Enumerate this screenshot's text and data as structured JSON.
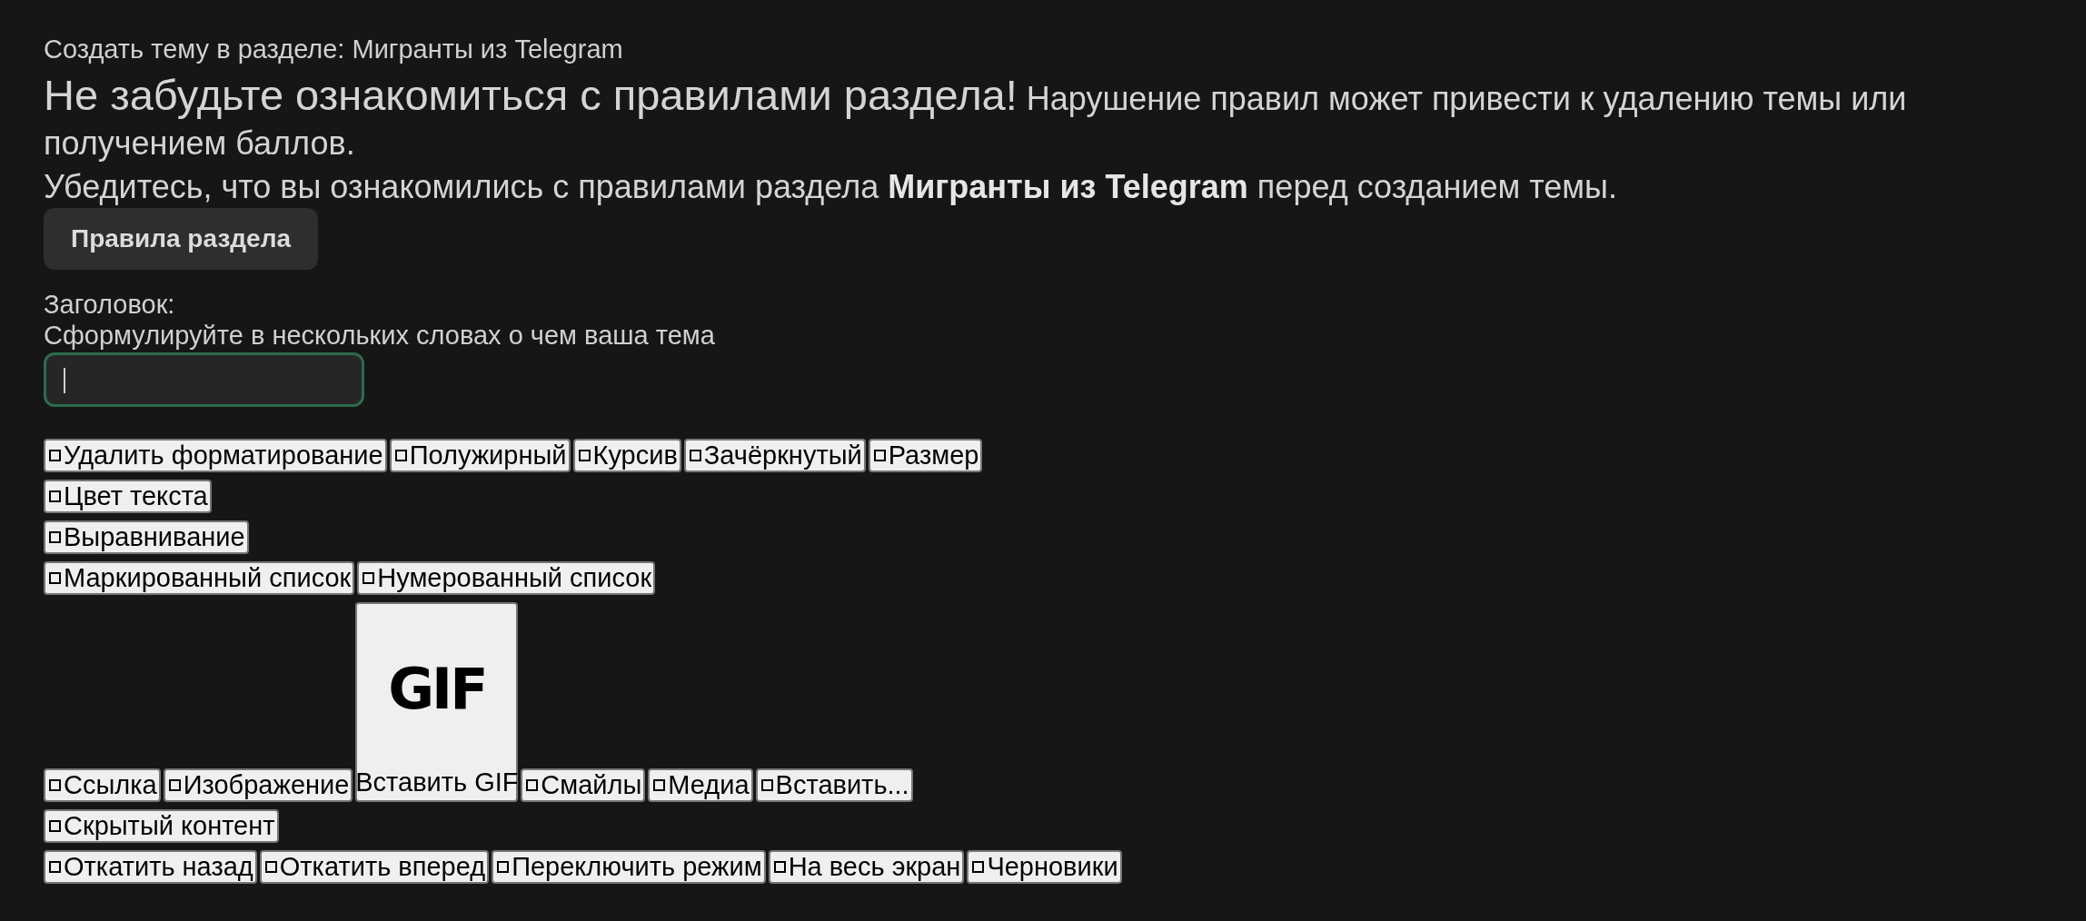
{
  "breadcrumb": "Создать тему в разделе: Мигранты из Telegram",
  "notice": {
    "headline": "Не забудьте ознакомиться с правилами раздела!",
    "text": "Нарушение правил может привести к удалению темы или получением баллов."
  },
  "reminder": "Убедитесь, что вы ознакомились с правилами раздела **Мигранты из Telegram** перед созданием темы.",
  "rules_button": {
    "label": "Правила раздела"
  },
  "title_field": {
    "label": "Заголовок:",
    "hint": "Сформулируйте в нескольких словах о чем ваша тема",
    "focused": true
  },
  "toolbar": {
    "lines": [
      {
        "buttons": [
          {
            "kind": "icon",
            "label": "Удалить форматирование"
          },
          {
            "kind": "icon",
            "label": "Полужирный"
          },
          {
            "kind": "icon",
            "label": "Курсив"
          },
          {
            "kind": "icon",
            "label": "Зачёркнутый"
          },
          {
            "kind": "icon",
            "label": "Размер"
          }
        ]
      },
      {
        "buttons": [
          {
            "kind": "icon",
            "label": "Цвет текста"
          }
        ]
      },
      {
        "buttons": [
          {
            "kind": "icon",
            "label": "Выравнивание"
          }
        ]
      },
      {
        "buttons": [
          {
            "kind": "icon",
            "label": "Маркированный список"
          },
          {
            "kind": "icon",
            "label": "Нумерованный список"
          }
        ]
      },
      {
        "buttons": [
          {
            "kind": "icon",
            "label": "Ссылка"
          },
          {
            "kind": "icon",
            "label": "Изображение"
          },
          {
            "kind": "gif",
            "logo": "GIF",
            "label": "Вставить GIF"
          },
          {
            "kind": "icon",
            "label": "Смайлы"
          },
          {
            "kind": "icon",
            "label": "Медиа"
          },
          {
            "kind": "icon",
            "label": "Вставить..."
          }
        ]
      },
      {
        "buttons": [
          {
            "kind": "icon",
            "label": "Скрытый контент"
          }
        ]
      },
      {
        "buttons": [
          {
            "kind": "icon",
            "label": "Откатить назад"
          },
          {
            "kind": "icon",
            "label": "Откатить вперед"
          },
          {
            "kind": "icon",
            "label": "Переключить режим"
          },
          {
            "kind": "icon",
            "label": "На весь экран"
          },
          {
            "kind": "icon",
            "label": "Черновики"
          }
        ]
      }
    ]
  }
}
